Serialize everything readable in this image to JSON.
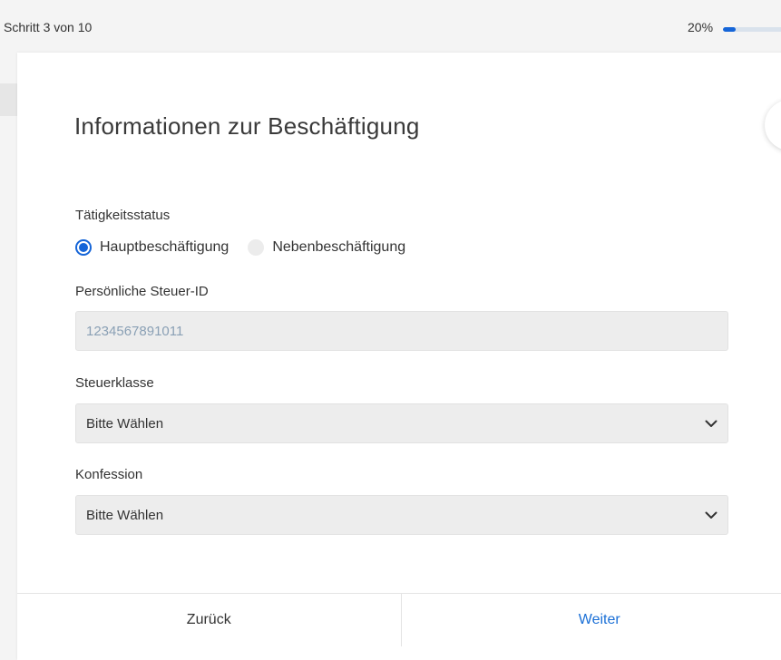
{
  "header": {
    "step_text": "Schritt 3 von 10",
    "progress_text": "20%",
    "progress_value": 0.2
  },
  "form": {
    "title": "Informationen zur Beschäftigung",
    "activity_status": {
      "label": "Tätigkeitsstatus",
      "options": [
        {
          "label": "Hauptbeschäftigung",
          "selected": true
        },
        {
          "label": "Nebenbeschäftigung",
          "selected": false
        }
      ]
    },
    "tax_id": {
      "label": "Persönliche Steuer-ID",
      "value": "1234567891011"
    },
    "tax_class": {
      "label": "Steuerklasse",
      "value": "Bitte Wählen"
    },
    "confession": {
      "label": "Konfession",
      "value": "Bitte Wählen"
    }
  },
  "footer": {
    "back_label": "Zurück",
    "next_label": "Weiter"
  },
  "colors": {
    "accent": "#1565d8",
    "link": "#1a6fd6",
    "input_bg": "#ededed",
    "readonly_text": "#8aa0b5"
  },
  "icons": {
    "select_chevron": "chevron-down-icon"
  }
}
